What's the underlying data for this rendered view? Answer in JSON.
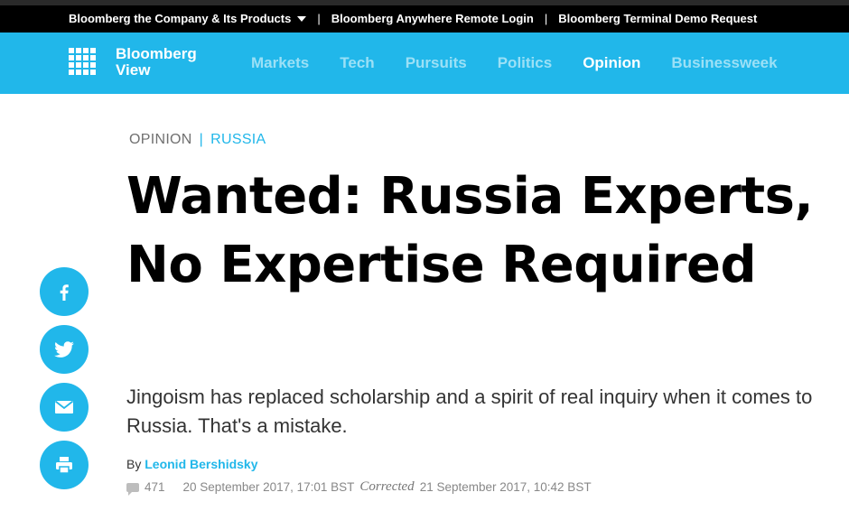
{
  "topbar": {
    "company_label": "Bloomberg the Company & Its Products",
    "separator": "|",
    "remote_login_label": "Bloomberg Anywhere Remote Login",
    "demo_label": "Bloomberg Terminal Demo Request"
  },
  "nav": {
    "logo_line1": "Bloomberg",
    "logo_line2": "View",
    "items": [
      {
        "label": "Markets"
      },
      {
        "label": "Tech"
      },
      {
        "label": "Pursuits"
      },
      {
        "label": "Politics"
      },
      {
        "label": "Opinion"
      },
      {
        "label": "Businessweek"
      }
    ],
    "active_item": "Opinion"
  },
  "article": {
    "section": "OPINION",
    "kicker_separator": "|",
    "topic": "RUSSIA",
    "headline": "Wanted: Russia Experts, No Expertise Required",
    "dek": "Jingoism has replaced scholarship and a spirit of real inquiry when it comes to Russia. That's a mistake.",
    "by_label": "By",
    "author": "Leonid Bershidsky",
    "comment_count": "471",
    "published": "20 September 2017, 17:01 BST",
    "corrected_label": "Corrected",
    "corrected_date": "21 September 2017, 10:42 BST"
  },
  "share_buttons": [
    {
      "icon": "facebook-icon"
    },
    {
      "icon": "twitter-icon"
    },
    {
      "icon": "email-icon"
    },
    {
      "icon": "print-icon"
    }
  ],
  "colors": {
    "brand_blue": "#21b7ea",
    "nav_inactive": "#9be0f6",
    "topbar_bg": "#000000"
  }
}
